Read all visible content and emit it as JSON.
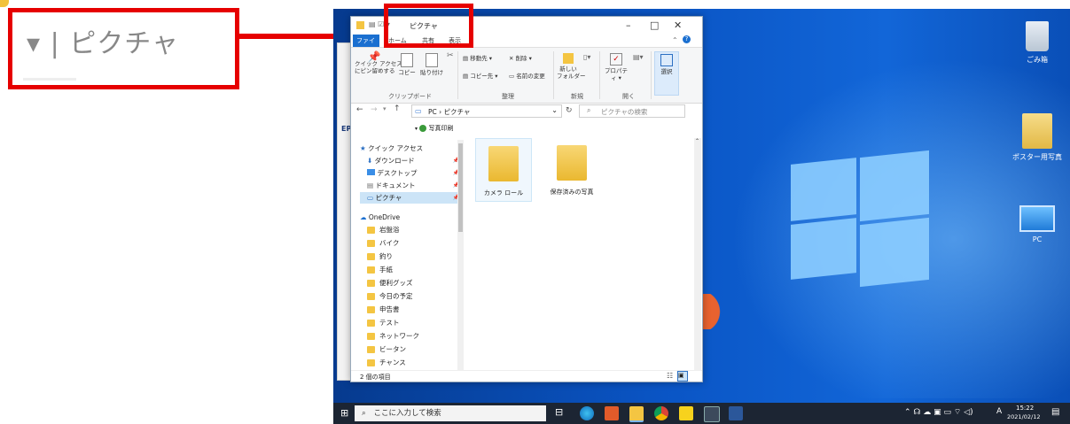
{
  "zoom": {
    "text": "▾ | ピクチャ"
  },
  "explorer": {
    "title": "ピクチャ",
    "tabs": [
      "ファイル",
      "ホーム",
      "共有",
      "表示"
    ],
    "ribbon": {
      "pin_label": "クイック アクセス\nにピン留めする",
      "copy_label": "コピー",
      "paste_label": "貼り付け",
      "clipboard_group": "クリップボード",
      "move_to": "移動先",
      "copy_to": "コピー先",
      "delete": "削除",
      "rename": "名前の変更",
      "organize_group": "整理",
      "new_folder": "新しい\nフォルダー",
      "new_group": "新規",
      "properties": "プロパティ",
      "open_group": "開く",
      "select": "選択"
    },
    "address": "PC › ピクチャ",
    "search_placeholder": "ピクチャの検索",
    "photo_print": "写真印刷",
    "nav": {
      "quick_access": "クイック アクセス",
      "quick_items": [
        "ダウンロード",
        "デスクトップ",
        "ドキュメント",
        "ピクチャ"
      ],
      "onedrive": "OneDrive",
      "onedrive_items": [
        "岩盤浴",
        "バイク",
        "釣り",
        "手紙",
        "便利グッズ",
        "今日の予定",
        "申告書",
        "テスト",
        "ネットワーク",
        "ビータン",
        "チャンス"
      ]
    },
    "folders": [
      "カメラ ロール",
      "保存済みの写真"
    ],
    "status": "2 個の項目"
  },
  "desktop": {
    "icons": [
      "ごみ箱",
      "ポスター用写真",
      "PC"
    ],
    "partial_label": "EP"
  },
  "taskbar": {
    "search_placeholder": "ここに入力して検索",
    "time": "15:22",
    "date": "2021/02/12",
    "ime": "A"
  }
}
